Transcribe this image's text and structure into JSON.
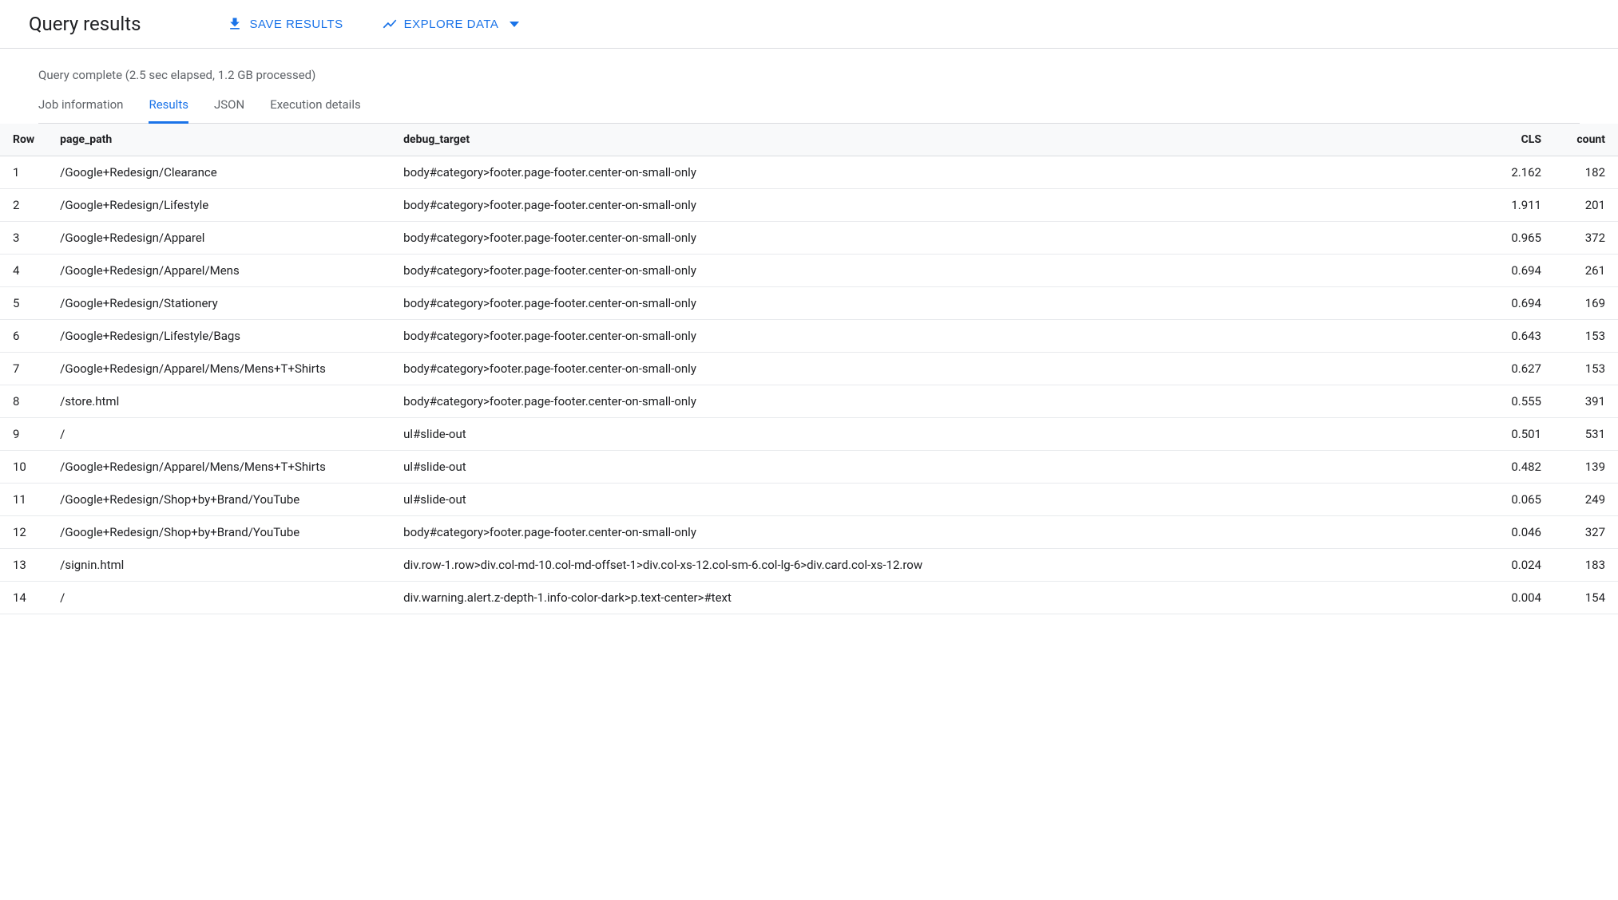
{
  "header": {
    "title": "Query results",
    "save_label": "Save Results",
    "explore_label": "Explore Data"
  },
  "status": "Query complete (2.5 sec elapsed, 1.2 GB processed)",
  "tabs": [
    {
      "label": "Job information",
      "active": false
    },
    {
      "label": "Results",
      "active": true
    },
    {
      "label": "JSON",
      "active": false
    },
    {
      "label": "Execution details",
      "active": false
    }
  ],
  "table": {
    "columns": [
      "Row",
      "page_path",
      "debug_target",
      "CLS",
      "count"
    ],
    "rows": [
      {
        "row": "1",
        "page_path": "/Google+Redesign/Clearance",
        "debug_target": "body#category>footer.page-footer.center-on-small-only",
        "cls": "2.162",
        "count": "182"
      },
      {
        "row": "2",
        "page_path": "/Google+Redesign/Lifestyle",
        "debug_target": "body#category>footer.page-footer.center-on-small-only",
        "cls": "1.911",
        "count": "201"
      },
      {
        "row": "3",
        "page_path": "/Google+Redesign/Apparel",
        "debug_target": "body#category>footer.page-footer.center-on-small-only",
        "cls": "0.965",
        "count": "372"
      },
      {
        "row": "4",
        "page_path": "/Google+Redesign/Apparel/Mens",
        "debug_target": "body#category>footer.page-footer.center-on-small-only",
        "cls": "0.694",
        "count": "261"
      },
      {
        "row": "5",
        "page_path": "/Google+Redesign/Stationery",
        "debug_target": "body#category>footer.page-footer.center-on-small-only",
        "cls": "0.694",
        "count": "169"
      },
      {
        "row": "6",
        "page_path": "/Google+Redesign/Lifestyle/Bags",
        "debug_target": "body#category>footer.page-footer.center-on-small-only",
        "cls": "0.643",
        "count": "153"
      },
      {
        "row": "7",
        "page_path": "/Google+Redesign/Apparel/Mens/Mens+T+Shirts",
        "debug_target": "body#category>footer.page-footer.center-on-small-only",
        "cls": "0.627",
        "count": "153"
      },
      {
        "row": "8",
        "page_path": "/store.html",
        "debug_target": "body#category>footer.page-footer.center-on-small-only",
        "cls": "0.555",
        "count": "391"
      },
      {
        "row": "9",
        "page_path": "/",
        "debug_target": "ul#slide-out",
        "cls": "0.501",
        "count": "531"
      },
      {
        "row": "10",
        "page_path": "/Google+Redesign/Apparel/Mens/Mens+T+Shirts",
        "debug_target": "ul#slide-out",
        "cls": "0.482",
        "count": "139"
      },
      {
        "row": "11",
        "page_path": "/Google+Redesign/Shop+by+Brand/YouTube",
        "debug_target": "ul#slide-out",
        "cls": "0.065",
        "count": "249"
      },
      {
        "row": "12",
        "page_path": "/Google+Redesign/Shop+by+Brand/YouTube",
        "debug_target": "body#category>footer.page-footer.center-on-small-only",
        "cls": "0.046",
        "count": "327"
      },
      {
        "row": "13",
        "page_path": "/signin.html",
        "debug_target": "div.row-1.row>div.col-md-10.col-md-offset-1>div.col-xs-12.col-sm-6.col-lg-6>div.card.col-xs-12.row",
        "cls": "0.024",
        "count": "183"
      },
      {
        "row": "14",
        "page_path": "/",
        "debug_target": "div.warning.alert.z-depth-1.info-color-dark>p.text-center>#text",
        "cls": "0.004",
        "count": "154"
      }
    ]
  }
}
